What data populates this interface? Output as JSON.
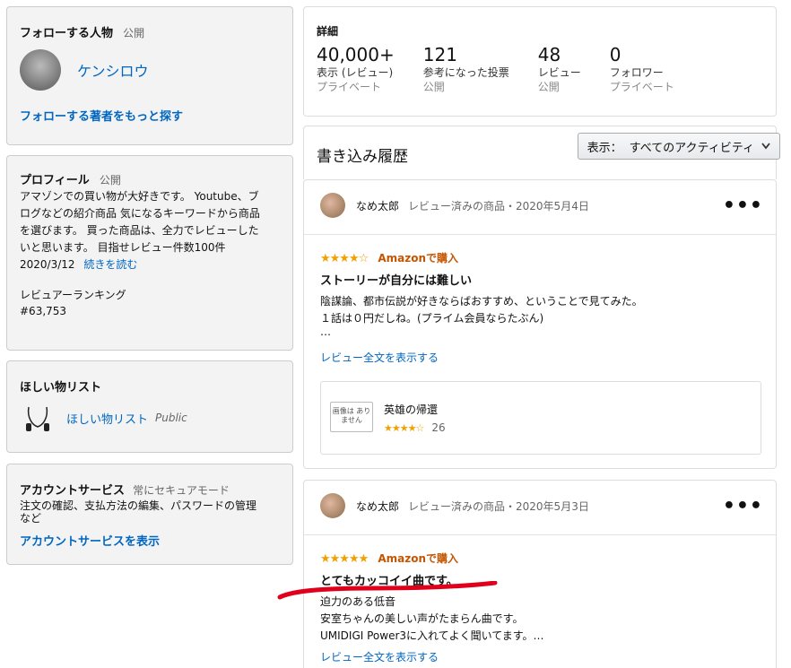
{
  "follow": {
    "title": "フォローする人物",
    "visibility": "公開",
    "person_name": "ケンシロウ",
    "more_link": "フォローする著者をもっと探す"
  },
  "profile": {
    "title": "プロフィール",
    "visibility": "公開",
    "bio_line1": "アマゾンでの買い物が大好きです。 Youtube、ブ",
    "bio_line2": "ログなどの紹介商品 気になるキーワードから商品",
    "bio_line3": "を選びます。 買った商品は、全力でレビューした",
    "bio_line4": "いと思います。 目指せレビュー件数100件",
    "bio_date": "2020/3/12",
    "read_more": "続きを読む",
    "ranking_label": "レビュアーランキング",
    "ranking_value": "#63,753"
  },
  "wishlist": {
    "title": "ほしい物リスト",
    "item_name": "ほしい物リスト",
    "item_visibility": "Public"
  },
  "account": {
    "title": "アカウントサービス",
    "mode": "常にセキュアモード",
    "desc_line1": "注文の確認、支払方法の編集、パスワードの管理",
    "desc_line2": "など",
    "link": "アカウントサービスを表示"
  },
  "details": {
    "title": "詳細",
    "stats": [
      {
        "num": "40,000+",
        "label": "表示 (レビュー)",
        "sub": "プライベート"
      },
      {
        "num": "121",
        "label": "参考になった投票",
        "sub": "公開"
      },
      {
        "num": "48",
        "label": "レビュー",
        "sub": "公開"
      },
      {
        "num": "0",
        "label": "フォロワー",
        "sub": "プライベート"
      }
    ]
  },
  "history": {
    "title": "書き込み履歴",
    "filter_prefix": "表示：",
    "filter_value": "すべてのアクティビティ"
  },
  "reviews": [
    {
      "user": "なめ太郎",
      "meta": "レビュー済みの商品・2020年5月4日",
      "stars": "★★★★☆",
      "badge": "Amazonで購入",
      "title": "ストーリーが自分には難しい",
      "body1": "陰謀論、都市伝説が好きならばおすすめ、ということで見てみた。",
      "body2": "１話は０円だしね。(プライム会員ならたぶん)",
      "body3": "…",
      "full_link": "レビュー全文を表示する",
      "product_name": "英雄の帰還",
      "product_stars": "★★★★☆",
      "product_count": "26",
      "noimage": "画像は ありません"
    },
    {
      "user": "なめ太郎",
      "meta": "レビュー済みの商品・2020年5月3日",
      "stars": "★★★★★",
      "badge": "Amazonで購入",
      "title": "とてもカッコイイ曲です。",
      "body1": "迫力のある低音",
      "body2": "安室ちゃんの美しい声がたまらん曲です。",
      "body3": "UMIDIGI Power3に入れてよく聞いてます。…",
      "full_link": "レビュー全文を表示する"
    }
  ],
  "colors": {
    "link": "#0066c0",
    "star": "#f0a100",
    "badge": "#c45500",
    "annotation": "#e0001b"
  }
}
